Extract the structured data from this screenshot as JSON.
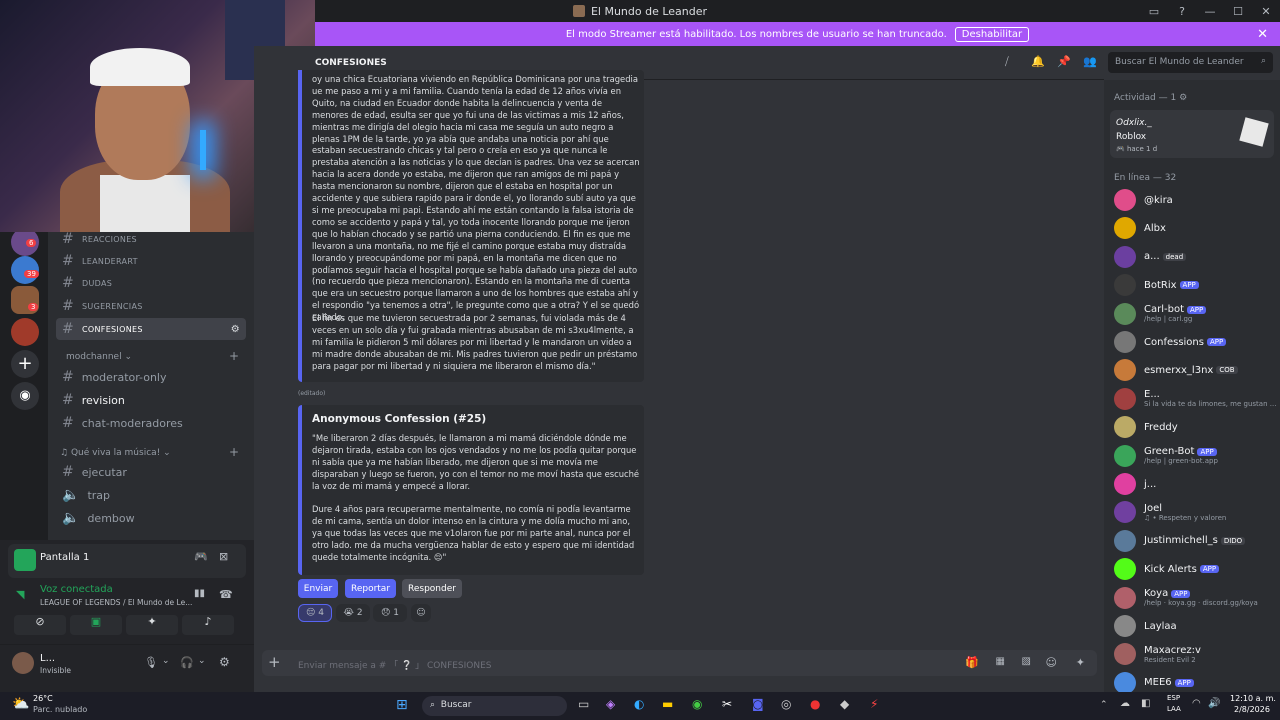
{
  "window": {
    "title": "El Mundo de Leander"
  },
  "streamer_banner": {
    "text": "El modo Streamer está habilitado. Los nombres de usuario se han truncado.",
    "button": "Deshabilitar"
  },
  "channel_header": {
    "name": "CONFESIONES",
    "search_placeholder": "Buscar El Mundo de Leander"
  },
  "server_badges": [
    "6",
    "39",
    "3"
  ],
  "channels": [
    {
      "label": "REACCIONES",
      "style": "small"
    },
    {
      "label": "LEANDERART",
      "style": "small"
    },
    {
      "label": "DUDAS",
      "style": "small"
    },
    {
      "label": "SUGERENCIAS",
      "style": "small"
    },
    {
      "label": "CONFESIONES",
      "style": "active"
    }
  ],
  "categories": {
    "mod": "modchannel",
    "music": "Qué viva la música!"
  },
  "mod_channels": [
    "moderator-only",
    "revision",
    "chat-moderadores"
  ],
  "music_channels": [
    "ejecutar",
    "trap",
    "dembow"
  ],
  "voice_panel": {
    "stream_title": "Pantalla 1",
    "status": "Voz conectada",
    "location": "LEAGUE OF LEGENDS / El Mundo de Le...",
    "user_name": "L...",
    "user_status": "Invisible"
  },
  "message1": {
    "text": "oy una chica Ecuatoriana viviendo en República Dominicana por una tragedia ue me paso a mi y a mi familia. Cuando tenía la edad de 12 años vivía en Quito, na ciudad en Ecuador donde habita la delincuencia y venta de menores de edad, esulta ser que yo fui una de las victimas a mis 12 años, mientras me dirigía del olegio hacia mi casa me seguía un auto negro a plenas 1PM de la tarde, yo ya abía que andaba una noticia por ahí que estaban secuestrando chicas y tal pero o creía en eso ya que nunca le prestaba atención a las noticias y lo que decían is padres. Una vez se acercan hacia la acera donde yo estaba, me dijeron que ran amigos de mi papá y hasta mencionaron su nombre, dijeron que el estaba en hospital por un accidente y que subiera rapido para ir donde el, yo llorando subí auto ya que si me preocupaba mi papi. Estando ahí me están contando la falsa istoria de como se accidento y papá y tal, yo toda inocente llorando porque me ijeron que lo habían chocado y se partió una pierna conduciendo. El fin es que me llevaron a una montaña, no me fijé el camino porque estaba muy distraída llorando y preocupándome por mi papá, en la montaña me dicen que no podíamos seguir hacia el hospital porque se había dañado una pieza del auto (no recuerdo que pieza mencionaron). Estando en la montaña me di cuenta que era un secuestro porque llamaron a uno de los hombres que estaba ahí y el respondio \"ya tenemos a otra\", le pregunte como que a otra? Y el se quedó callado.",
    "text2": "El fin es que me tuvieron secuestrada por 2 semanas, fui violada más de 4 veces en un solo día y fui grabada mientras abusaban de mi s3xu4lmente, a mi familia le pidieron 5 mil dólares por mi libertad y le mandaron un video a mi madre donde abusaban de mi. Mis padres tuvieron que pedir un préstamo para pagar por mi libertad y ni siquiera me liberaron el mismo día.\"",
    "edited": "(editado)"
  },
  "message2": {
    "title": "Anonymous Confession (#25)",
    "text": "\"Me liberaron 2 días después, le llamaron a mi mamá diciéndole dónde me dejaron tirada, estaba con los ojos vendados y no me los podía quitar porque ni sabía que ya me habían liberado, me dijeron que si me movía me disparaban y luego se fueron, yo con el temor no me moví hasta que escuché la voz de mi mamá y empecé a llorar.",
    "text2": "Dure 4 años para recuperarme mentalmente, no comía ni podía levantarme de mi cama, sentía un dolor intenso en la cintura y me dolía mucho mi ano, ya que todas las veces que me v1olaron fue por mi parte anal, nunca por el otro lado. me da mucha vergüenza hablar de esto y espero que mi identidad quede totalmente incógnita. 😔\"",
    "buttons": [
      "Enviar",
      "Reportar",
      "Responder"
    ],
    "reactions": [
      {
        "emoji": "😔",
        "count": "4"
      },
      {
        "emoji": "😭",
        "count": "2"
      },
      {
        "emoji": "😞",
        "count": "1"
      }
    ]
  },
  "composer": {
    "placeholder": "Enviar mensaje a # 「 ❔ 」 CONFESIONES"
  },
  "members": {
    "activity_header": "Actividad — 1",
    "activity": {
      "user": "Odxlix._",
      "game": "Roblox",
      "time": "hace 1 d"
    },
    "online_header": "En línea — 32",
    "list": [
      {
        "name": "@kira",
        "sub": "",
        "tag": "",
        "color": "#e04d8a"
      },
      {
        "name": "Albx",
        "sub": "",
        "tag": "",
        "color": "#e0a800"
      },
      {
        "name": "a...",
        "sub": "",
        "tag": "dead",
        "color": "#6b3fa0"
      },
      {
        "name": "BotRix",
        "sub": "",
        "tag": "APP",
        "color": "#3a3a3a"
      },
      {
        "name": "Carl-bot",
        "sub": "/help | carl.gg",
        "tag": "APP",
        "color": "#5a8a5a"
      },
      {
        "name": "Confessions",
        "sub": "",
        "tag": "APP",
        "color": "#777"
      },
      {
        "name": "esmerxx_l3nx",
        "sub": "",
        "tag": "COB",
        "color": "#c77a3a"
      },
      {
        "name": "E...",
        "sub": "Si la vida te da limones, me gustan ...",
        "tag": "",
        "color": "#a04040"
      },
      {
        "name": "Freddy",
        "sub": "",
        "tag": "",
        "color": "#bbaa66"
      },
      {
        "name": "Green-Bot",
        "sub": "/help | green-bot.app",
        "tag": "APP",
        "color": "#3aa55a"
      },
      {
        "name": "j...",
        "sub": "",
        "tag": "",
        "color": "#e040a0"
      },
      {
        "name": "Joel",
        "sub": "♫ • Respeten y valoren",
        "tag": "",
        "color": "#7040a0"
      },
      {
        "name": "Justinmichell_s",
        "sub": "",
        "tag": "DIDO",
        "color": "#5a7a9a"
      },
      {
        "name": "Kick Alerts",
        "sub": "",
        "tag": "APP",
        "color": "#53fc18"
      },
      {
        "name": "Koya",
        "sub": "/help · koya.gg · discord.gg/koya",
        "tag": "APP",
        "color": "#b0606a"
      },
      {
        "name": "Laylaa",
        "sub": "",
        "tag": "",
        "color": "#888"
      },
      {
        "name": "Maxacrez:v",
        "sub": "Resident Evil 2",
        "tag": "",
        "color": "#a06060"
      },
      {
        "name": "MEE6",
        "sub": "",
        "tag": "APP",
        "color": "#4a8adf"
      }
    ]
  },
  "taskbar": {
    "weather_temp": "26°C",
    "weather_desc": "Parc. nublado",
    "search": "Buscar",
    "lang1": "ESP",
    "lang2": "LAA",
    "time": "12:10 a. m.",
    "date": "2/8/2026"
  }
}
